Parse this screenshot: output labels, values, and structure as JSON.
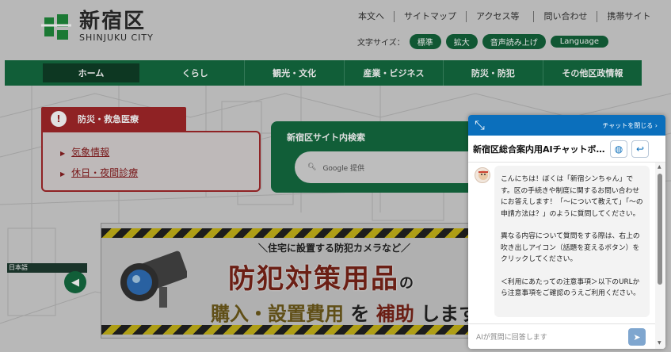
{
  "header": {
    "logo_jp": "新宿区",
    "logo_en": "SHINJUKU CITY",
    "top_links": [
      "本文へ",
      "サイトマップ",
      "アクセス等",
      "問い合わせ",
      "携帯サイト"
    ],
    "font_size_label": "文字サイズ：",
    "font_buttons": [
      "標準",
      "拡大",
      "音声読み上げ",
      "Language"
    ]
  },
  "nav": {
    "items": [
      "ホーム",
      "くらし",
      "観光・文化",
      "産業・ビジネス",
      "防災・防犯",
      "その他区政情報"
    ]
  },
  "disaster": {
    "title": "防災・救急医療",
    "links": [
      "気象情報",
      "休日・夜間診療"
    ]
  },
  "site_search": {
    "title": "新宿区サイト内検索",
    "placeholder": "Google 提供"
  },
  "language_label": "日本語",
  "banner": {
    "sub": "＼住宅に設置する防犯カメラなど／",
    "main": "防犯対策用品",
    "main_suffix": "の",
    "line2_a": "購入・設置費用",
    "line2_b": "を",
    "line2_c": "補助",
    "line2_d": "します"
  },
  "chat": {
    "close_label": "チャットを閉じる ›",
    "title": "新宿区総合案内用AIチャットボット",
    "messages": [
      "こんにちは！ぼくは「新宿シンちゃん」です。区の手続きや制度に関するお問い合わせにお答えします！「〜について教えて」「〜の申請方法は？」のように質問してください。",
      "異なる内容について質問をする際は、右上の吹き出しアイコン（話題を変えるボタン）をクリックしてください。",
      "＜利用にあたっての注意事項＞以下のURLから注意事項をご確認のうえご利用ください。"
    ],
    "input_placeholder": "AIが質問に回答します"
  }
}
